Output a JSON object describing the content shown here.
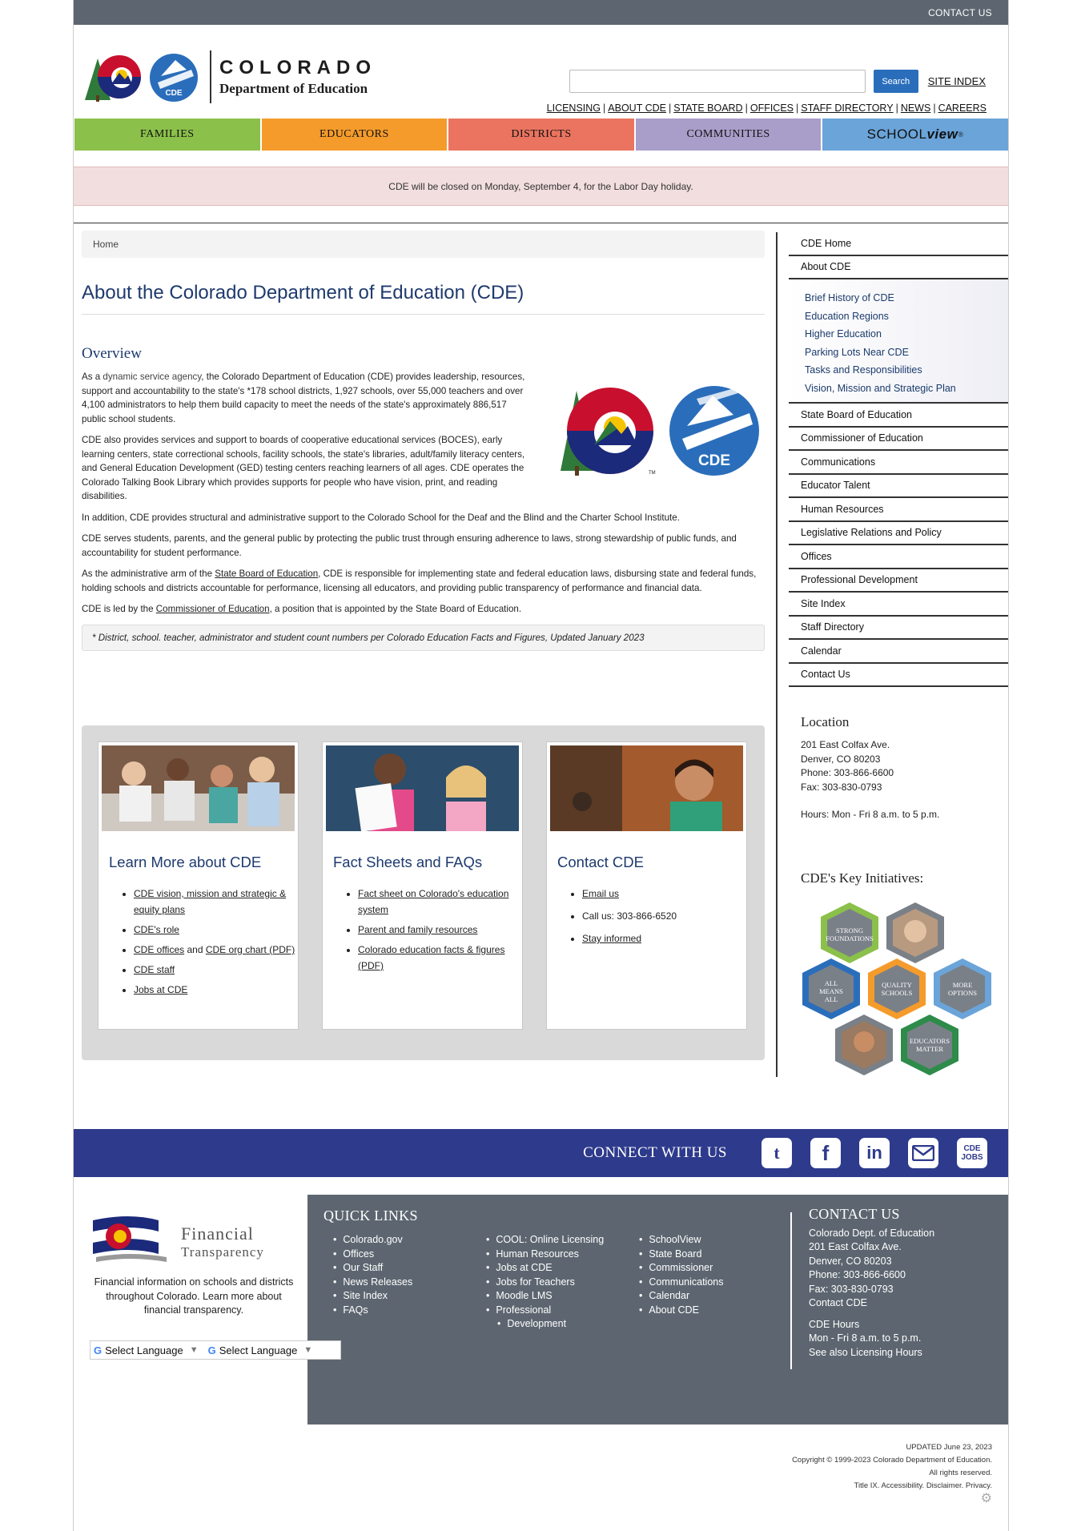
{
  "topbar": {
    "contact": "CONTACT US"
  },
  "header": {
    "wordmark_big": "COLORADO",
    "wordmark_small": "Department of Education",
    "logo_badge": "CDE",
    "search_placeholder": "",
    "search_button": "Search",
    "site_index": "SITE INDEX",
    "links": [
      "LICENSING",
      "ABOUT CDE",
      "STATE BOARD",
      "OFFICES",
      "STAFF DIRECTORY",
      "NEWS",
      "CAREERS"
    ]
  },
  "nav": {
    "families": "FAMILIES",
    "educators": "EDUCATORS",
    "districts": "DISTRICTS",
    "communities": "COMMUNITIES",
    "schoolview_a": "SCHOOL",
    "schoolview_b": "view",
    "schoolview_c": "®"
  },
  "alert": "CDE will be closed on Monday, September 4, for the Labor Day holiday.",
  "breadcrumb": "Home",
  "main": {
    "title": "About the Colorado Department of Education (CDE)",
    "overview_heading": "Overview",
    "p1_link": "dynamic service agency",
    "p1_pre": "As a ",
    "p1_post": ", the Colorado Department of Education (CDE) provides leadership, resources, support and accountability to the state's *178 school districts, 1,927 schools, over 55,000 teachers and over 4,100 administrators to help them build capacity to meet the needs of the state's approximately 886,517 public school students.",
    "p2": "CDE also provides services and support to boards of cooperative educational services (BOCES), early learning centers, state correctional schools, facility schools, the state's libraries, adult/family literacy centers, and General Education Development (GED) testing centers reaching learners of all ages. CDE operates the Colorado Talking Book Library which provides supports for people who have vision, print, and reading disabilities.",
    "p3": "In addition, CDE provides structural and administrative support to the Colorado School for the Deaf and the Blind and the Charter School Institute.",
    "p4": "CDE serves students, parents, and the general public by protecting the public trust through ensuring adherence to laws, strong stewardship of public funds, and accountability for student performance.",
    "p5_pre": "As the administrative arm of the ",
    "p5_link": "State Board of Education",
    "p5_post": ", CDE is responsible for implementing state and federal education laws, disbursing state and federal funds, holding schools and districts accountable for performance, licensing all educators, and providing public transparency of performance and financial data.",
    "p6_pre": "CDE is led by the ",
    "p6_link": "Commissioner of Education",
    "p6_post": ", a position that is appointed by the State Board of Education.",
    "note_pre": "* District, school. teacher, administrator and student count numbers per ",
    "note_link": "Colorado Education Facts and Figures",
    "note_post": ", Updated January 2023",
    "big_logo_badge": "CDE",
    "big_logo_tm": "TM"
  },
  "cards": [
    {
      "title": "Learn More about CDE"
    },
    {
      "title": "Fact Sheets and FAQs"
    },
    {
      "title": "Contact CDE"
    }
  ],
  "card1": {
    "l1": "CDE vision, mission and strategic & equity plans",
    "l2": "CDE's role",
    "l3a": "CDE offices",
    "l3b": " and ",
    "l3c": "CDE org chart (PDF)",
    "l4": "CDE staff",
    "l5": "Jobs at CDE"
  },
  "card2": {
    "l1": "Fact sheet on Colorado's education system",
    "l2": "Parent and family resources",
    "l3": "Colorado education facts & figures (PDF)"
  },
  "card3": {
    "l1": "Email us",
    "l2": "Call us: 303-866-6520",
    "l3": "Stay informed"
  },
  "sidebar": {
    "cde_home": "CDE Home",
    "about": "About CDE",
    "sub": [
      "Brief History of CDE",
      "Education Regions",
      "Higher Education",
      "Parking Lots Near CDE",
      "Tasks and Responsibilities",
      "Vision, Mission and Strategic Plan"
    ],
    "items": [
      "State Board of Education",
      "Commissioner of Education",
      "Communications",
      "Educator Talent",
      "Human Resources",
      "Legislative Relations and Policy",
      "Offices",
      "Professional Development",
      "Site Index",
      "Staff Directory",
      "Calendar",
      "Contact Us"
    ]
  },
  "location": {
    "heading": "Location",
    "addr1": "201 East Colfax Ave.",
    "addr2": "Denver, CO 80203",
    "phone": "Phone: 303-866-6600",
    "fax": "Fax: 303-830-0793",
    "hours": "Hours: Mon - Fri 8 a.m. to 5 p.m."
  },
  "initiatives": {
    "heading": "CDE's Key Initiatives:",
    "h1": "STRONG",
    "h1b": "FOUNDATIONS",
    "h2": "ALL",
    "h2b": "MEANS",
    "h2c": "ALL",
    "h3": "QUALITY",
    "h3b": "SCHOOLS",
    "h4": "MORE",
    "h4b": "OPTIONS",
    "h5": "EDUCATORS",
    "h5b": "MATTER"
  },
  "connect": {
    "label": "CONNECT WITH US",
    "twitter": "t",
    "facebook": "f",
    "linkedin": "in",
    "jobs_a": "CDE",
    "jobs_b": "JOBS"
  },
  "footer": {
    "ft_word1": "Financial",
    "ft_word2": "Transparency",
    "ft_desc_pre": "Financial information on schools and districts throughout Colorado. ",
    "ft_desc_link": "Learn more about financial transparency.",
    "lang1": "Select Language",
    "lang2": "Select Language",
    "quick_links": "QUICK LINKS",
    "ql_col1": [
      "Colorado.gov",
      "Offices",
      "Our Staff",
      "News Releases",
      "Site Index",
      "FAQs"
    ],
    "ql_col2": [
      "COOL: Online Licensing",
      "Human Resources",
      "Jobs at CDE",
      "Jobs for Teachers",
      "Moodle LMS",
      "Professional",
      "Development"
    ],
    "ql_col3": [
      "SchoolView",
      "State Board",
      "Commissioner",
      "Communications",
      "Calendar",
      "About CDE"
    ],
    "contact_heading": "CONTACT US",
    "c1": "Colorado Dept. of Education",
    "c2": "201 East Colfax Ave.",
    "c3": "Denver, CO 80203",
    "c4": "Phone: 303-866-6600",
    "c5": "Fax: 303-830-0793",
    "c6": "Contact CDE",
    "c7": "CDE Hours",
    "c8": "Mon - Fri 8 a.m. to 5 p.m.",
    "c9_pre": "See also ",
    "c9_link": "Licensing Hours"
  },
  "bottom": {
    "updated": "UPDATED June 23, 2023",
    "copyright": "Copyright © 1999-2023 Colorado Department of Education.",
    "rights": "All rights reserved.",
    "title_ix": "Title IX",
    "accessibility": "Accessibility",
    "disclaimer": "Disclaimer",
    "privacy": "Privacy"
  }
}
